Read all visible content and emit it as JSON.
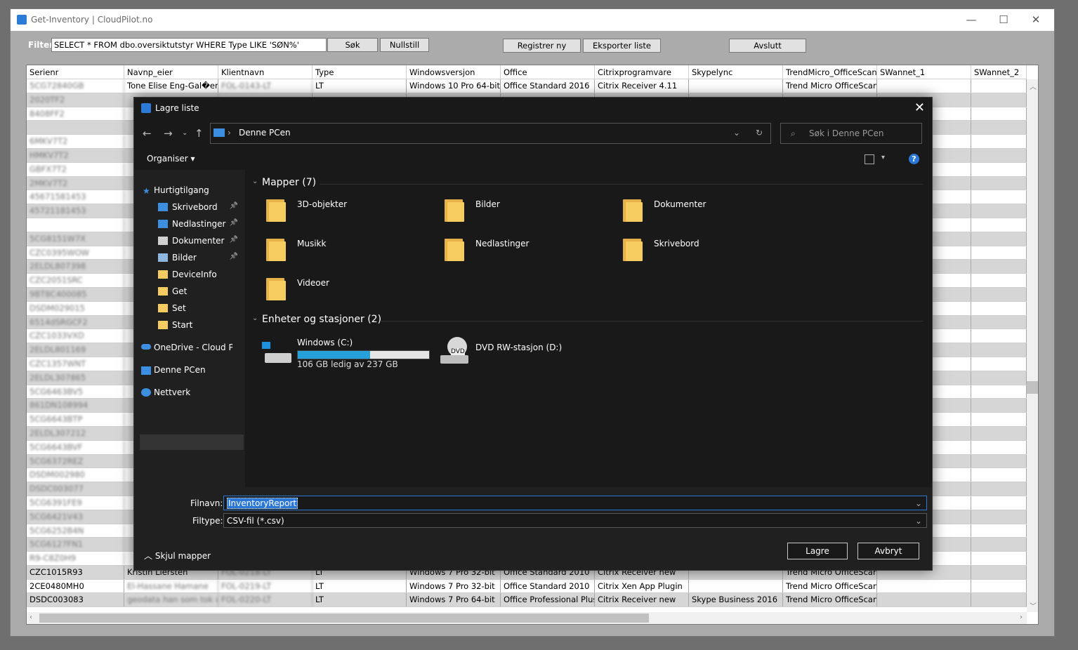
{
  "window": {
    "title": "Get-Inventory | CloudPilot.no",
    "minimize": "—",
    "maximize": "☐",
    "close": "✕"
  },
  "toolbar": {
    "filter_label": "Filter:",
    "filter_value": "SELECT * FROM dbo.oversiktutstyr WHERE Type LIKE 'SØN%'",
    "search_button": "Søk",
    "reset_button": "Nullstill",
    "register_button": "Registrer ny",
    "export_button": "Eksporter liste",
    "exit_button": "Avslutt"
  },
  "grid": {
    "columns": [
      "Serienr",
      "Navnp_eier",
      "Klientnavn",
      "Type",
      "Windowsversjon",
      "Office",
      "Citrixprogramvare",
      "Skypelync",
      "TrendMicro_OfficeScan",
      "SWannet_1",
      "SWannet_2"
    ],
    "first_row": [
      "5CG72840GB",
      "Tone Elise Eng-Gal�en",
      "FOL-0143-LT",
      "LT",
      "Windows 10 Pro 64-bit",
      "Office Standard 2016",
      "Citrix Receiver 4.11",
      "",
      "Trend Micro OfficeScan (",
      "",
      ""
    ],
    "serials": [
      "2020TF2",
      "8408FF2",
      "",
      "6MKV7T2",
      "HMKV7T2",
      "GBFX7T2",
      "2MKV7T2",
      "45671581453",
      "45721181453",
      "",
      "5CG8151W7X",
      "CZC0395WOW",
      "2ELDL807398",
      "CZC2051SRC",
      "9BT8C400085",
      "DSDM029015",
      "6514dSRGCF2",
      "CZC1033VXD",
      "2ELDL801169",
      "CZC1357WNT",
      "2ELDL307865",
      "5CG6463BV5",
      "861DN108994",
      "5CG6643BTP",
      "2ELDL307212",
      "5CG6643BVF",
      "5CG6372REZ",
      "DSDM002980",
      "DSDC003077",
      "5CG6391FE9",
      "5CG6421V43",
      "5CG6252B4N",
      "5CG6127FN1",
      "R9-C8Z0H9"
    ],
    "partial_cell": "n CC 201!",
    "bottom_rows": [
      [
        "CZC1015R93",
        "Kristin Liersten",
        "FOL-0218-LT",
        "LT",
        "Windows 7 Pro 32-bit",
        "Office Standard 2010",
        "Citrix Receiver new",
        "",
        "Trend Micro OfficeScan (",
        "",
        ""
      ],
      [
        "2CE0480MH0",
        "El-Hassane Hamane",
        "FOL-0219-LT",
        "LT",
        "Windows 7 Pro 32-bit",
        "Office Standard 2010",
        "Citrix Xen App Plugin",
        "",
        "Trend Micro OfficeScan (",
        "",
        ""
      ],
      [
        "DSDC003083",
        "geodata han som tok ov",
        "FOL-0220-LT",
        "LT",
        "Windows 7 Pro 64-bit",
        "Office Professional Plus",
        "Citrix Receiver new",
        "Skype Business 2016",
        "Trend Micro OfficeScan (",
        "",
        ""
      ]
    ]
  },
  "dialog": {
    "title": "Lagre liste",
    "close": "✕",
    "breadcrumb_sep": "›",
    "location": "Denne PCen",
    "search_placeholder": "Søk i Denne PCen",
    "organize": "Organiser",
    "help": "?",
    "nav": {
      "quick_access": "Hurtigtilgang",
      "items": [
        "Skrivebord",
        "Nedlastinger",
        "Dokumenter",
        "Bilder",
        "DeviceInfo",
        "Get",
        "Set",
        "Start"
      ],
      "onedrive": "OneDrive - Cloud Pilot",
      "this_pc": "Denne PCen",
      "network": "Nettverk"
    },
    "folders_header": "Mapper (7)",
    "folders": [
      "3D-objekter",
      "Bilder",
      "Dokumenter",
      "Musikk",
      "Nedlastinger",
      "Skrivebord",
      "Videoer"
    ],
    "drives_header": "Enheter og stasjoner (2)",
    "drive_c": {
      "name": "Windows (C:)",
      "free": "106 GB ledig av 237 GB",
      "used_fraction": 0.553
    },
    "drive_d": {
      "name": "DVD RW-stasjon (D:)",
      "label": "DVD"
    },
    "filename_label": "Filnavn:",
    "filename_value": "InventoryReport",
    "filetype_label": "Filtype:",
    "filetype_value": "CSV-fil (*.csv)",
    "hide_folders": "Skjul mapper",
    "save_button": "Lagre",
    "cancel_button": "Avbryt"
  }
}
